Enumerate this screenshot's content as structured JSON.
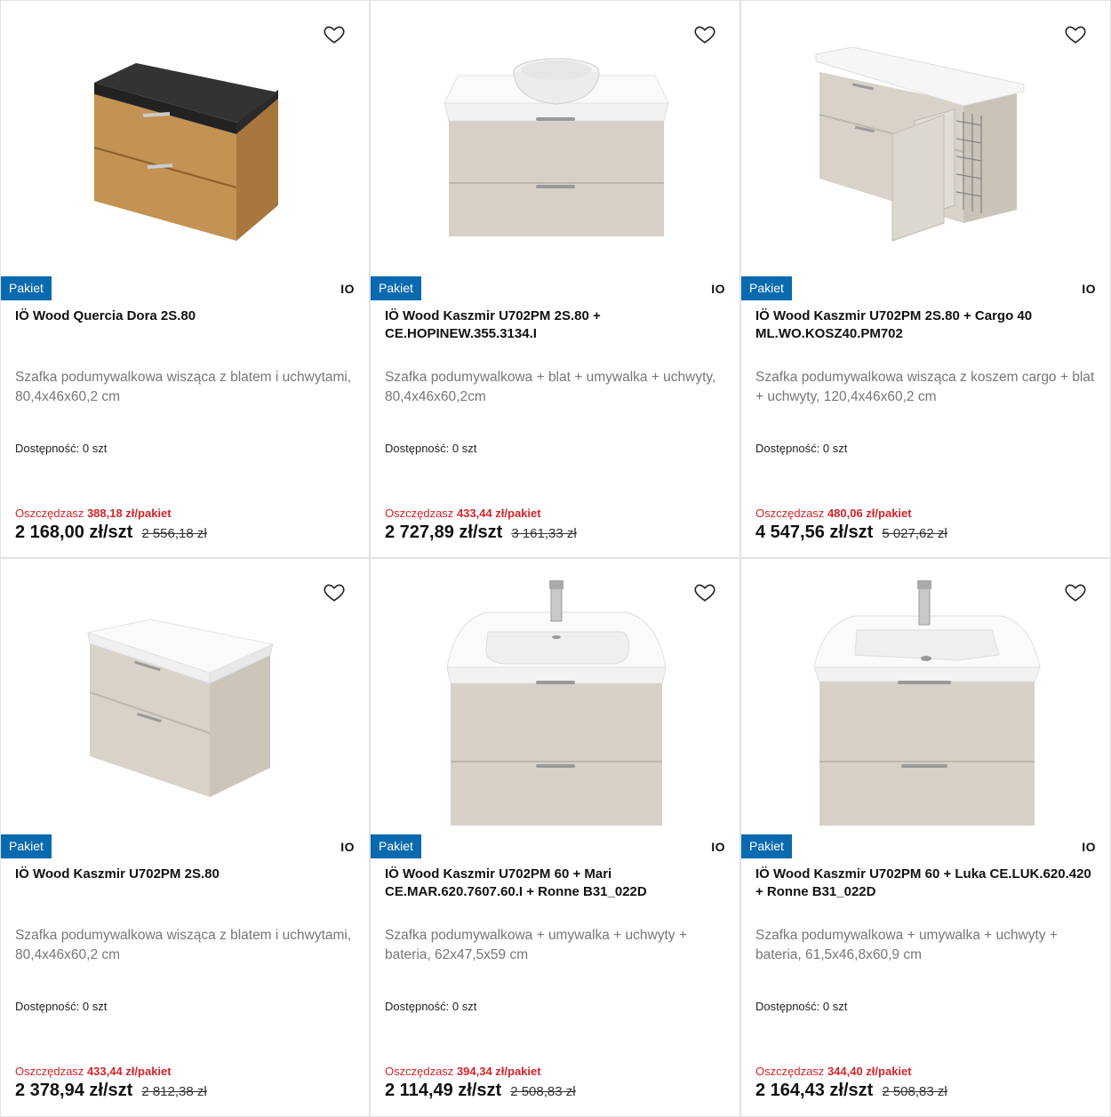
{
  "badge_label": "Pakiet",
  "brand_label": "IO",
  "availability_label": "Dostępność:",
  "save_prefix": "Oszczędzasz",
  "products": [
    {
      "title": "IÖ Wood Quercia Dora 2S.80",
      "description": "Szafka podumywalkowa wisząca z blatem i uchwytami, 80,4x46x60,2 cm",
      "availability": "0 szt",
      "savings": "388,18 zł/pakiet",
      "price": "2 168,00 zł/szt",
      "old_price": "2 556,18 zł",
      "image": "oak-cabinet-black-top"
    },
    {
      "title": "IÖ Wood Kaszmir U702PM 2S.80 + CE.HOPINEW.355.3134.I",
      "description": "Szafka podumywalkowa + blat + umywalka + uchwyty, 80,4x46x60,2cm",
      "availability": "0 szt",
      "savings": "433,44 zł/pakiet",
      "price": "2 727,89 zł/szt",
      "old_price": "3 161,33 zł",
      "image": "beige-cabinet-bowl-basin"
    },
    {
      "title": "IÖ Wood Kaszmir U702PM 2S.80 + Cargo 40 ML.WO.KOSZ40.PM702",
      "description": "Szafka podumywalkowa wisząca z koszem cargo + blat + uchwyty, 120,4x46x60,2 cm",
      "availability": "0 szt",
      "savings": "480,06 zł/pakiet",
      "price": "4 547,56 zł/szt",
      "old_price": "5 027,62 zł",
      "image": "beige-cabinet-cargo-basket"
    },
    {
      "title": "IÖ Wood Kaszmir U702PM 2S.80",
      "description": "Szafka podumywalkowa wisząca z blatem i uchwytami, 80,4x46x60,2 cm",
      "availability": "0 szt",
      "savings": "433,44 zł/pakiet",
      "price": "2 378,94 zł/szt",
      "old_price": "2 812,38 zł",
      "image": "beige-cabinet-white-top"
    },
    {
      "title": "IÖ Wood Kaszmir U702PM 60 + Mari CE.MAR.620.7607.60.I + Ronne B31_022D",
      "description": "Szafka podumywalkowa + umywalka + uchwyty + bateria, 62x47,5x59 cm",
      "availability": "0 szt",
      "savings": "394,34 zł/pakiet",
      "price": "2 114,49 zł/szt",
      "old_price": "2 508,83 zł",
      "image": "beige-cabinet-basin-faucet"
    },
    {
      "title": "IÖ Wood Kaszmir U702PM 60 + Luka CE.LUK.620.420 + Ronne B31_022D",
      "description": "Szafka podumywalkowa + umywalka + uchwyty + bateria, 61,5x46,8x60,9 cm",
      "availability": "0 szt",
      "savings": "344,40 zł/pakiet",
      "price": "2 164,43 zł/szt",
      "old_price": "2 508,83 zł",
      "image": "beige-cabinet-basin-faucet"
    }
  ]
}
